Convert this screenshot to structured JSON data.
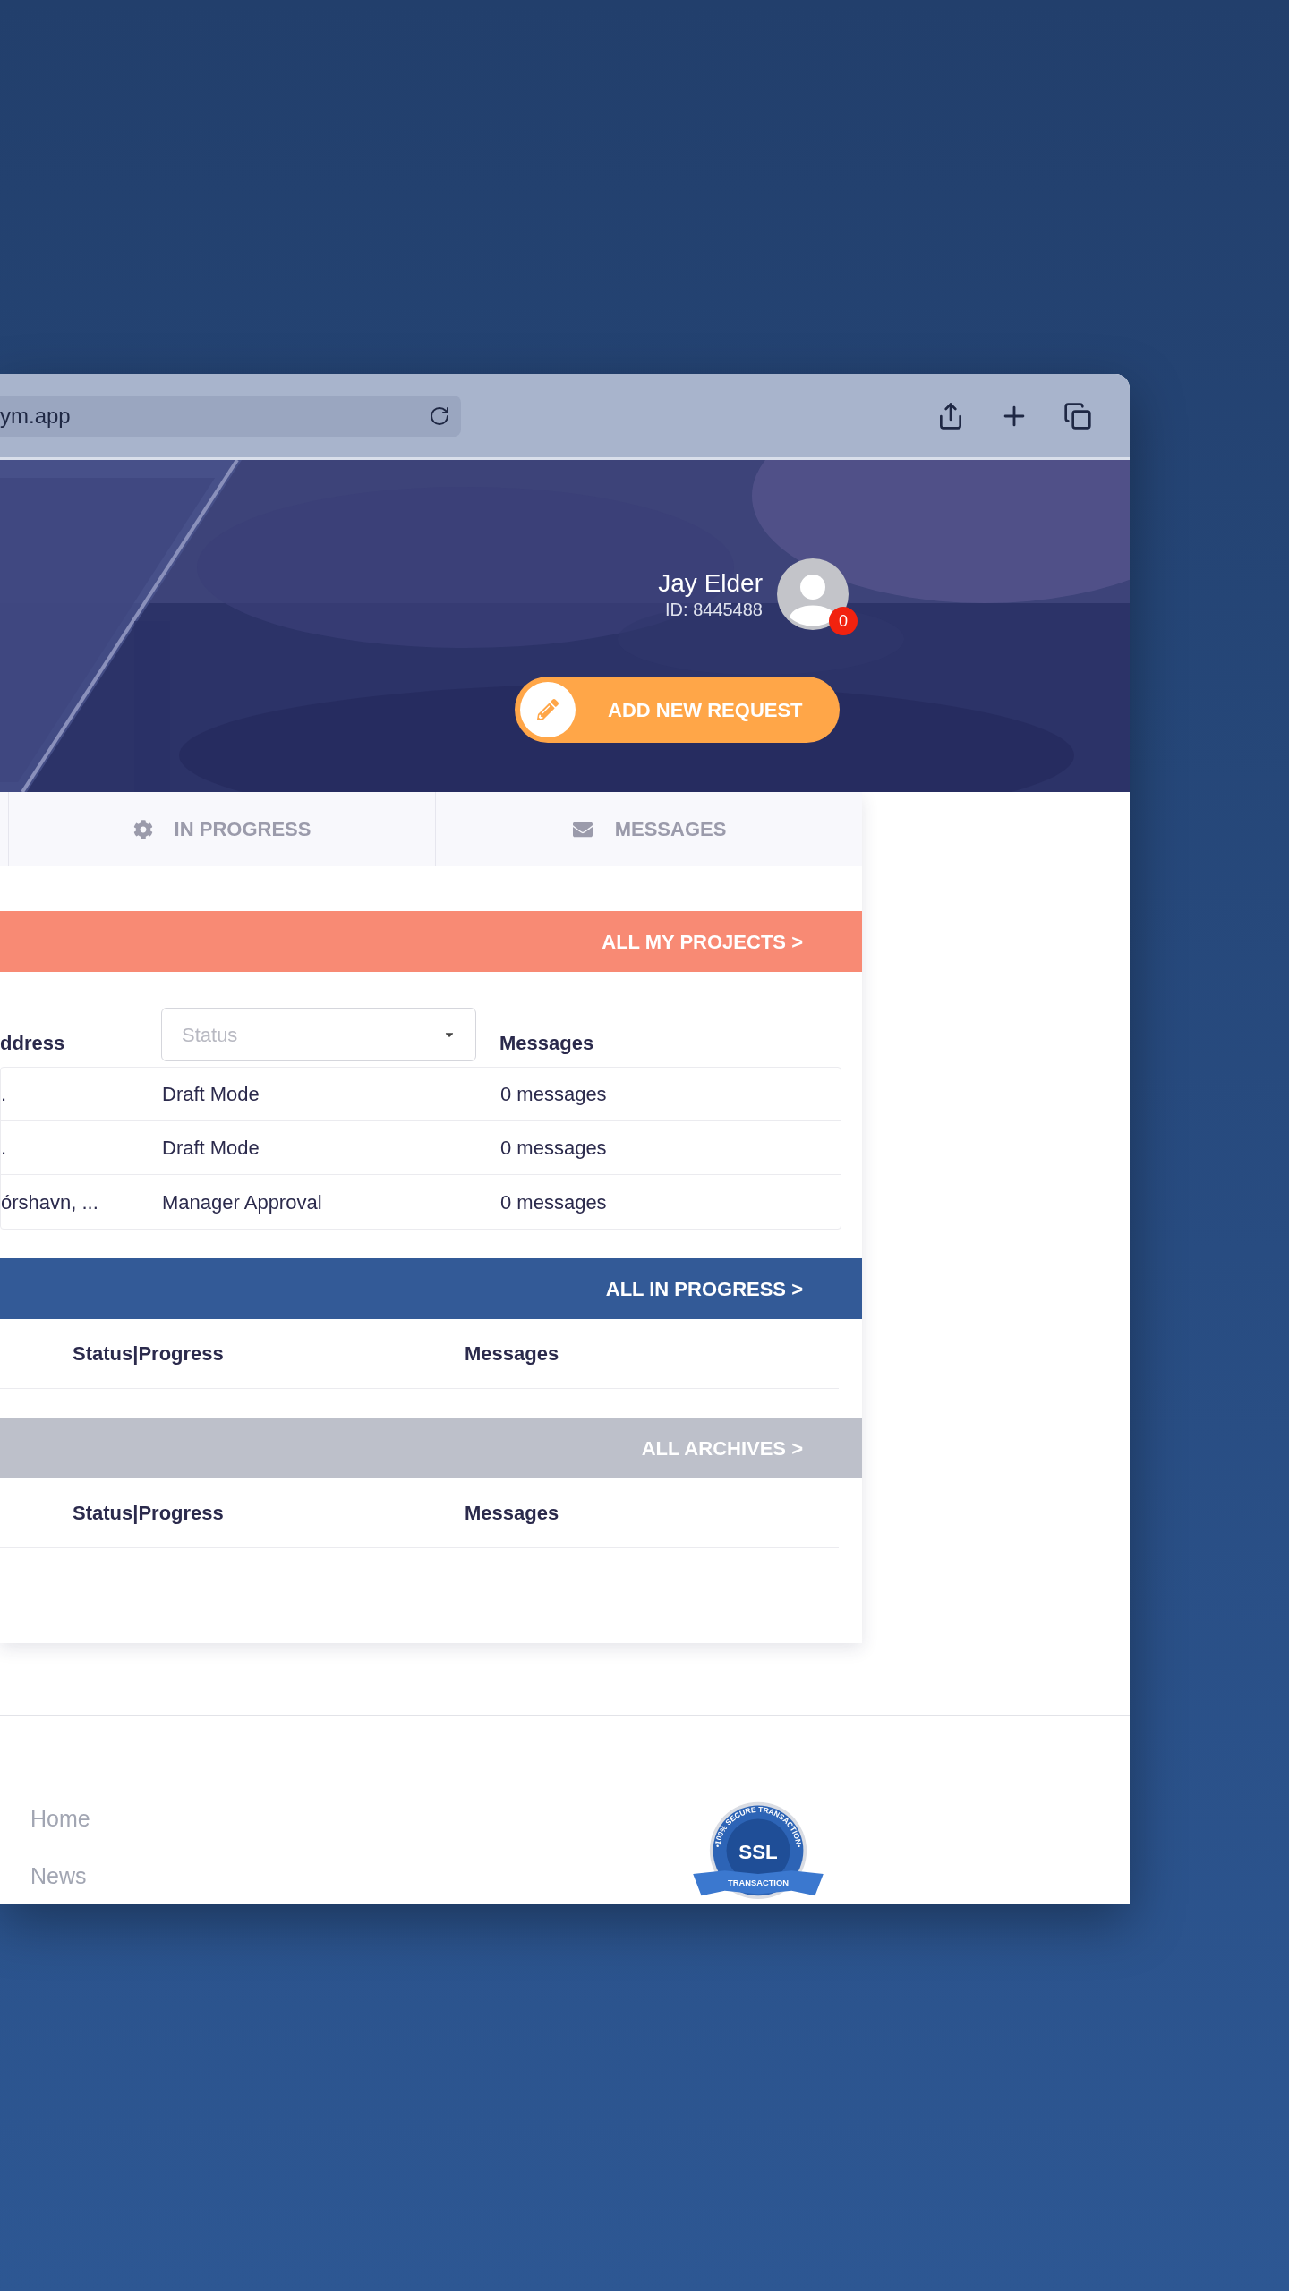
{
  "browser": {
    "url": "ym.app"
  },
  "profile": {
    "name": "Jay Elder",
    "id": "ID: 8445488",
    "badge": "0"
  },
  "add_button": "ADD NEW REQUEST",
  "tabs": [
    {
      "label": "IN PROGRESS",
      "selected": false
    },
    {
      "label": "MESSAGES",
      "selected": false
    }
  ],
  "sections": [
    {
      "kind": "projects",
      "link": "ALL MY PROJECTS >",
      "color": "#f88a74",
      "columns": [
        {
          "kind": "label",
          "label": "ddress"
        },
        {
          "kind": "filter",
          "placeholder": "Status"
        },
        {
          "kind": "label",
          "label": "Messages"
        }
      ],
      "rows": [
        [
          ".",
          "Draft Mode",
          "0 messages"
        ],
        [
          ".",
          "Draft Mode",
          "0 messages"
        ],
        [
          "órshavn, ...",
          "Manager Approval",
          "0 messages"
        ]
      ]
    },
    {
      "kind": "plain",
      "link": "ALL IN PROGRESS >",
      "color": "#335a97",
      "columns": [
        {
          "kind": "label",
          "label": "Status|Progress"
        },
        {
          "kind": "label",
          "label": "Messages"
        }
      ]
    },
    {
      "kind": "plain",
      "link": "ALL ARCHIVES >",
      "color": "#bdc0ca",
      "columns": [
        {
          "kind": "label",
          "label": "Status|Progress"
        },
        {
          "kind": "label",
          "label": "Messages"
        }
      ]
    }
  ],
  "footer": {
    "links": [
      "Home",
      "News"
    ],
    "ssl_badge": {
      "ring": "•100% SECURE TRANSACTION•",
      "title": "SSL",
      "ribbon": "TRANSACTION"
    }
  }
}
